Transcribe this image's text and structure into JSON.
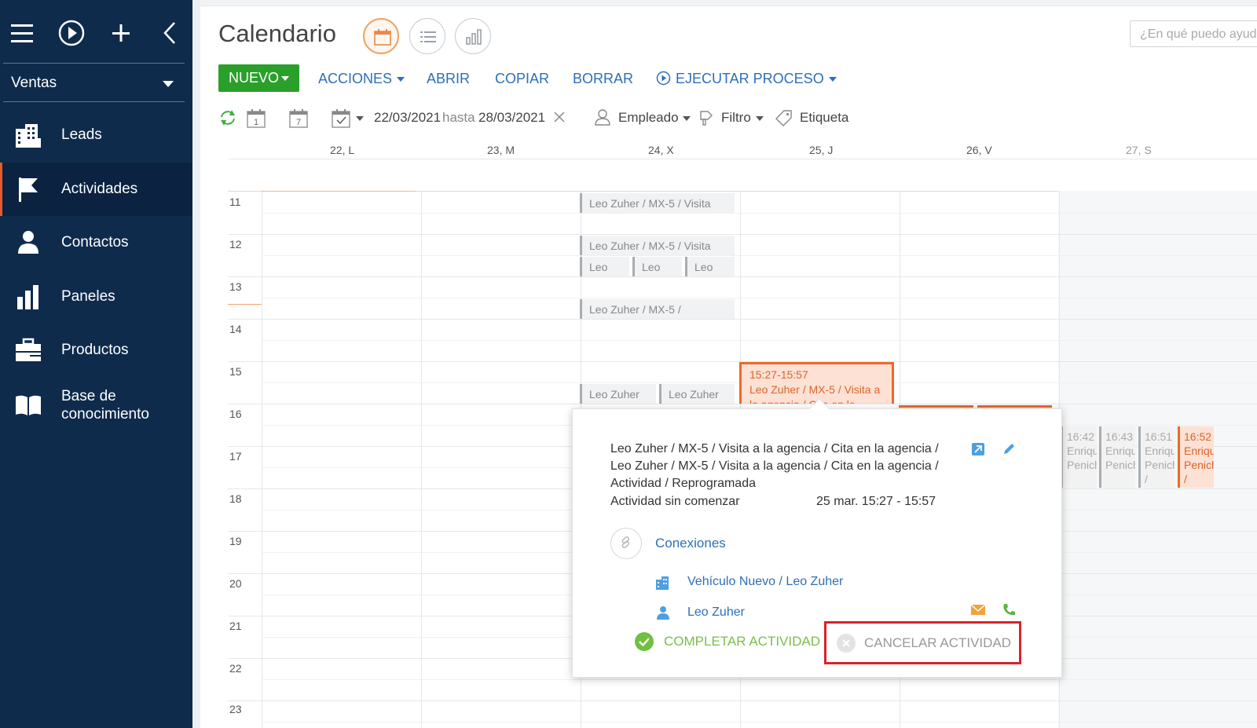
{
  "sidebar": {
    "workspace": "Ventas",
    "items": [
      {
        "label": "Leads",
        "icon": "building-icon"
      },
      {
        "label": "Actividades",
        "icon": "flag-icon"
      },
      {
        "label": "Contactos",
        "icon": "person-icon"
      },
      {
        "label": "Paneles",
        "icon": "bar-chart-icon"
      },
      {
        "label": "Productos",
        "icon": "briefcase-icon"
      },
      {
        "label": "Base de conocimiento",
        "icon": "book-icon"
      }
    ]
  },
  "header": {
    "title": "Calendario",
    "search_placeholder": "¿En qué puedo ayudarle?"
  },
  "toolbar": {
    "new": "NUEVO",
    "actions": "ACCIONES",
    "open": "ABRIR",
    "copy": "COPIAR",
    "delete": "BORRAR",
    "run_process": "EJECUTAR PROCESO"
  },
  "filters": {
    "date_from": "22/03/2021",
    "until": "hasta",
    "date_to": "28/03/2021",
    "employee": "Empleado",
    "filter": "Filtro",
    "tag": "Etiqueta",
    "day1": "1",
    "day7": "7"
  },
  "days": [
    "22, L",
    "23, M",
    "24, X",
    "25, J",
    "26, V",
    "27, S"
  ],
  "hours": [
    "11",
    "12",
    "13",
    "14",
    "15",
    "16",
    "17",
    "18",
    "19",
    "20",
    "21",
    "22",
    "23"
  ],
  "events": {
    "e1": "Leo Zuher / MX-5 / Visita",
    "e2": "Leo Zuher / MX-5 / Visita",
    "e3a": "Leo",
    "e3b": "Leo",
    "e3c": "Leo",
    "e4": "Leo Zuher / MX-5 /",
    "e5a": "Leo Zuher",
    "e5b": "Leo Zuher",
    "orange_time": "15:27-15:57",
    "orange_title": "Leo Zuher / MX-5 / Visita a la agencia / Cita en la agencia",
    "small": [
      {
        "time": "16:42",
        "text": "Enrique Penichet"
      },
      {
        "time": "16:43",
        "text": "Enrique Penichet"
      },
      {
        "time": "16:51",
        "text": "Enrique Penichet /"
      },
      {
        "time": "16:52",
        "text": "Enrique Penichet /"
      }
    ]
  },
  "popup": {
    "title": "Leo Zuher / MX-5 / Visita a la agencia / Cita en la agencia / Leo Zuher / MX-5 / Visita a la agencia / Cita en la agencia / Actividad / Reprogramada",
    "status": "Actividad sin comenzar",
    "datetime": "25 mar. 15:27 - 15:57",
    "connections_label": "Conexiones",
    "opportunity": "Vehículo Nuevo / Leo Zuher",
    "contact": "Leo Zuher",
    "complete": "COMPLETAR ACTIVIDAD",
    "cancel": "CANCELAR ACTIVIDAD"
  },
  "colors": {
    "sidebar_bg": "#0f2b4c",
    "accent_green": "#2aa02a",
    "link_blue": "#2d6fb8",
    "event_orange": "#ec6a2a",
    "highlight_red": "#d8232a"
  }
}
